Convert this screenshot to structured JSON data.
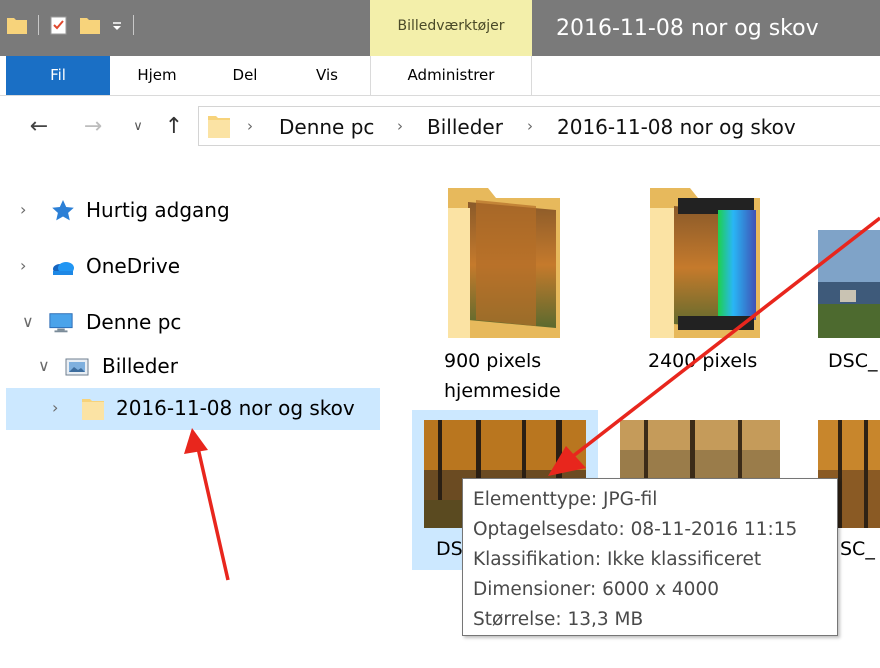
{
  "window": {
    "title": "2016-11-08 nor og skov",
    "context_tool": "Billedværktøjer"
  },
  "ribbon": {
    "tabs": [
      "Fil",
      "Hjem",
      "Del",
      "Vis",
      "Administrer"
    ]
  },
  "address": {
    "crumbs": [
      "Denne pc",
      "Billeder",
      "2016-11-08 nor og skov"
    ]
  },
  "nav_pane": {
    "quick_access": "Hurtig adgang",
    "onedrive": "OneDrive",
    "this_pc": "Denne pc",
    "pictures": "Billeder",
    "current_folder": "2016-11-08 nor og skov"
  },
  "content": {
    "folder1_line1": "900 pixels",
    "folder1_line2": "hjemmeside",
    "folder2": "2400 pixels",
    "file_partial_top": "DSC_",
    "file_partial_sel": "DS",
    "file_partial_right": "SC_"
  },
  "tooltip": {
    "type": "Elementtype: JPG-fil",
    "date": "Optagelsesdato: 08-11-2016 11:15",
    "rating": "Klassifikation: Ikke klassificeret",
    "dimensions": "Dimensioner: 6000 x 4000",
    "size": "Størrelse: 13,3 MB"
  },
  "colors": {
    "fil_tab": "#1a6fc5",
    "selection": "#cce8ff",
    "annotation_arrow": "#e8261d",
    "context_tab": "#f3efaa"
  }
}
